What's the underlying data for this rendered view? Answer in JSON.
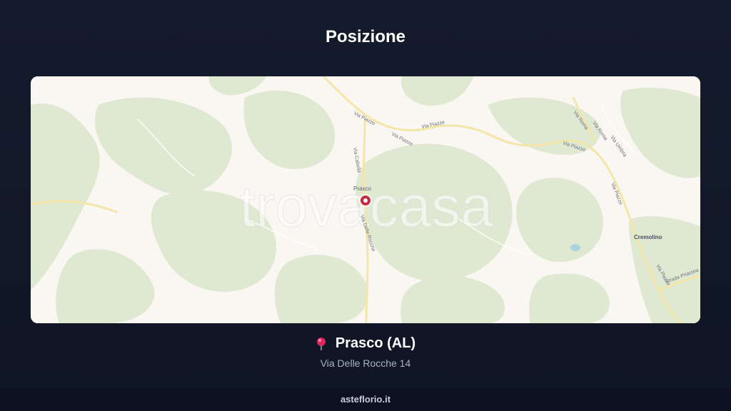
{
  "header": {
    "title": "Posizione"
  },
  "map": {
    "watermark": "trovacasa",
    "labels": {
      "marker_place": "Prasco",
      "town": "Cremolino",
      "road_1": "Via Piazze",
      "road_2": "Via Piazze",
      "road_3": "Via Piazze",
      "road_4": "Via Piazze",
      "road_5": "Via Piazze",
      "road_6": "Via Piazze",
      "road_7": "Via Cabella",
      "road_8": "Via Delle Rocche",
      "road_9": "Via Roma",
      "road_10": "Via Roma",
      "road_11": "Via Umbria",
      "road_12": "Strada Priarona"
    },
    "colors": {
      "land": "#faf6f1",
      "forest": "#dfe9d2",
      "road": "#f4e6a8",
      "marker": "#c62d42"
    },
    "marker_icon": "map-marker-icon"
  },
  "location": {
    "icon": "pin-icon",
    "name": "Prasco (AL)",
    "address": "Via Delle Rocche 14"
  },
  "footer": {
    "site": "asteflorio.it"
  }
}
